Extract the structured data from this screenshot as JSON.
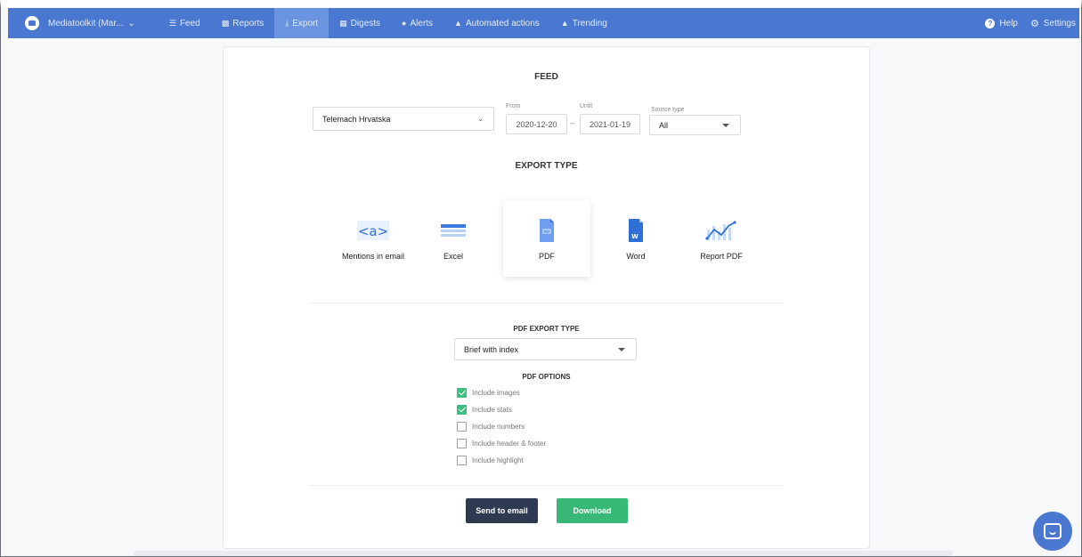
{
  "nav": {
    "brand": "Mediatoolkit (Mar...",
    "items": [
      {
        "label": "Feed",
        "icon": "list-icon"
      },
      {
        "label": "Reports",
        "icon": "bar-chart-icon"
      },
      {
        "label": "Export",
        "icon": "download-icon",
        "active": true
      },
      {
        "label": "Digests",
        "icon": "digest-icon"
      },
      {
        "label": "Alerts",
        "icon": "bell-icon"
      },
      {
        "label": "Automated actions",
        "icon": "robot-icon"
      },
      {
        "label": "Trending",
        "icon": "fire-icon"
      }
    ],
    "help": "Help",
    "settings": "Settings"
  },
  "feed": {
    "title": "FEED",
    "selected_feed": "Telemach Hrvatska",
    "from_label": "From",
    "from_value": "2020-12-20",
    "dash": "–",
    "until_label": "Until",
    "until_value": "2021-01-19",
    "source_label": "Source type",
    "source_value": "All"
  },
  "export_type": {
    "title": "EXPORT TYPE",
    "tiles": [
      {
        "label": "Mentions in email",
        "icon": "mention-email-icon"
      },
      {
        "label": "Excel",
        "icon": "excel-icon"
      },
      {
        "label": "PDF",
        "icon": "pdf-icon",
        "selected": true
      },
      {
        "label": "Word",
        "icon": "word-icon"
      },
      {
        "label": "Report PDF",
        "icon": "report-chart-icon"
      }
    ],
    "mention_glyph": "<a>",
    "pdf_glyph": "PDF",
    "word_glyph": "W"
  },
  "pdf_export": {
    "title": "PDF EXPORT TYPE",
    "value": "Brief with index"
  },
  "pdf_options": {
    "title": "PDF OPTIONS",
    "items": [
      {
        "label": "Include images",
        "checked": true
      },
      {
        "label": "Include stats",
        "checked": true
      },
      {
        "label": "Include numbers",
        "checked": false
      },
      {
        "label": "Include header & footer",
        "checked": false
      },
      {
        "label": "Include highlight",
        "checked": false
      }
    ]
  },
  "actions": {
    "send_email": "Send to email",
    "download": "Download"
  },
  "colors": {
    "nav": "#4a78d0",
    "send": "#2e3a52",
    "download": "#37b875",
    "check": "#3fbf7f"
  }
}
